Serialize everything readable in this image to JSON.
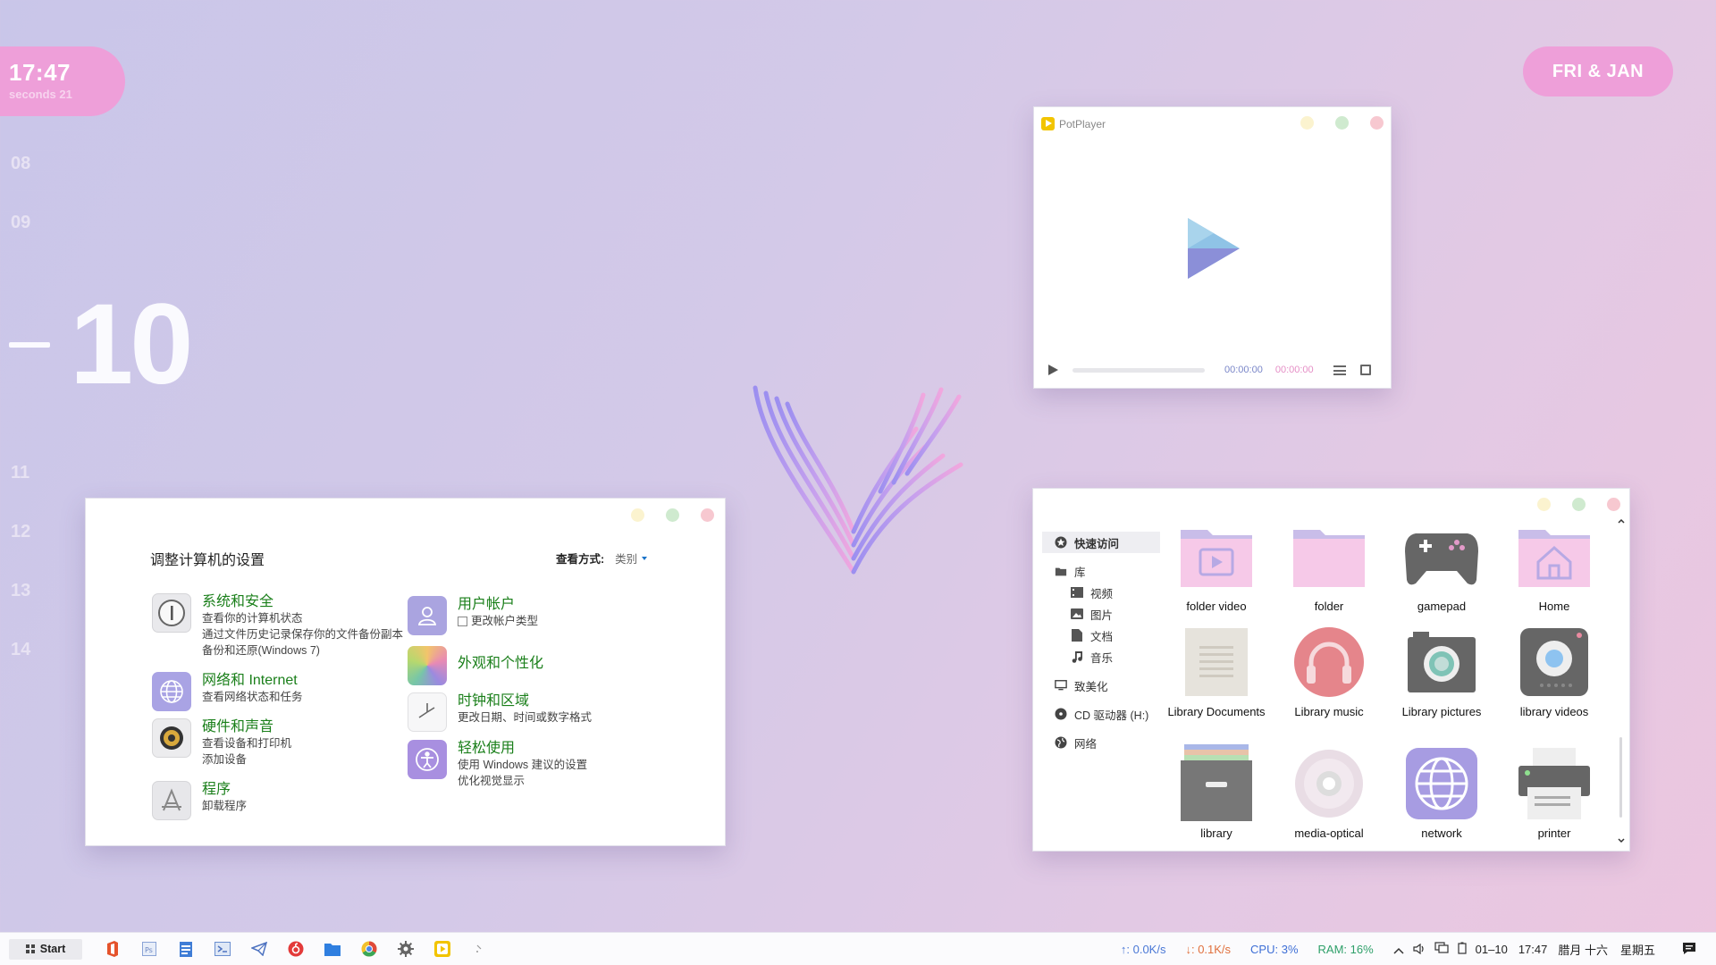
{
  "clock": {
    "time": "17:47",
    "seconds": "seconds 21"
  },
  "date_pill": "FRI & JAN",
  "calendar_days": {
    "before": [
      "08",
      "09"
    ],
    "current": "10",
    "after": [
      "11",
      "12",
      "13",
      "14"
    ]
  },
  "potplayer": {
    "title": "PotPlayer",
    "time_current": "00:00:00",
    "time_total": "00:00:00"
  },
  "control_panel": {
    "heading": "调整计算机的设置",
    "view_label": "查看方式:",
    "view_value": "类别",
    "items": [
      {
        "title": "系统和安全",
        "subs": [
          "查看你的计算机状态",
          "通过文件历史记录保存你的文件备份副本",
          "备份和还原(Windows 7)"
        ]
      },
      {
        "title": "网络和 Internet",
        "subs": [
          "查看网络状态和任务"
        ]
      },
      {
        "title": "硬件和声音",
        "subs": [
          "查看设备和打印机",
          "添加设备"
        ]
      },
      {
        "title": "程序",
        "subs": [
          "卸载程序"
        ]
      },
      {
        "title": "用户帐户",
        "subs": [
          "更改帐户类型"
        ]
      },
      {
        "title": "外观和个性化",
        "subs": []
      },
      {
        "title": "时钟和区域",
        "subs": [
          "更改日期、时间或数字格式"
        ]
      },
      {
        "title": "轻松使用",
        "subs": [
          "使用 Windows 建议的设置",
          "优化视觉显示"
        ]
      }
    ]
  },
  "explorer": {
    "sidebar": [
      {
        "label": "快速访问",
        "icon": "star-icon"
      },
      {
        "label": "库",
        "icon": "library-icon"
      },
      {
        "label": "视频",
        "icon": "video-icon"
      },
      {
        "label": "图片",
        "icon": "picture-icon"
      },
      {
        "label": "文档",
        "icon": "document-icon"
      },
      {
        "label": "音乐",
        "icon": "music-icon"
      },
      {
        "label": "致美化",
        "icon": "monitor-icon"
      },
      {
        "label": "CD 驱动器 (H:)",
        "icon": "cd-drive-icon"
      },
      {
        "label": "网络",
        "icon": "network-globe-icon"
      }
    ],
    "items": [
      {
        "label": "folder video",
        "icon": "folder-video-icon"
      },
      {
        "label": "folder",
        "icon": "folder-icon"
      },
      {
        "label": "gamepad",
        "icon": "gamepad-icon"
      },
      {
        "label": "Home",
        "icon": "home-folder-icon"
      },
      {
        "label": "Library Documents",
        "icon": "library-documents-icon"
      },
      {
        "label": "Library music",
        "icon": "library-music-icon"
      },
      {
        "label": "Library pictures",
        "icon": "library-pictures-icon"
      },
      {
        "label": "library videos",
        "icon": "library-videos-icon"
      },
      {
        "label": "library",
        "icon": "library-box-icon"
      },
      {
        "label": "media-optical",
        "icon": "media-optical-icon"
      },
      {
        "label": "network",
        "icon": "network-icon"
      },
      {
        "label": "printer",
        "icon": "printer-icon"
      }
    ]
  },
  "taskbar": {
    "start_label": "Start",
    "net_up": "↑: 0.0K/s",
    "net_down": "↓: 0.1K/s",
    "cpu": "CPU: 3%",
    "ram": "RAM: 16%",
    "date": "01–10",
    "time": "17:47",
    "lunar": "腊月 十六",
    "weekday": "星期五"
  },
  "colors": {
    "accent_pink": "#ee9fd9",
    "link_green": "#1a7f1a",
    "bg_lavender": "#cdc7ea"
  }
}
